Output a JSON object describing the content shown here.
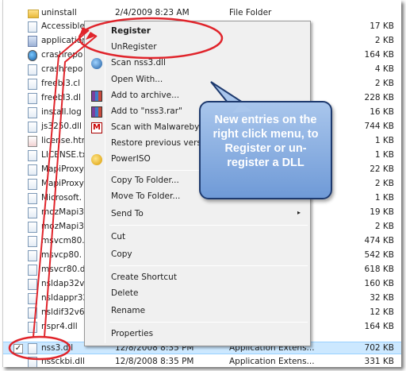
{
  "files": [
    {
      "name": "uninstall",
      "date": "2/4/2009 8:23 AM",
      "type": "File Folder",
      "size": "",
      "icon": "folder-icon"
    },
    {
      "name": "Accessible",
      "date": "",
      "type": "",
      "size": "17 KB",
      "icon": "file-icon"
    },
    {
      "name": "application",
      "date": "",
      "type": "",
      "size": "2 KB",
      "icon": "file-icon"
    },
    {
      "name": "crashrepo",
      "date": "",
      "type": "",
      "size": "164 KB",
      "icon": "crash-icon"
    },
    {
      "name": "crashrepo",
      "date": "",
      "type": "",
      "size": "4 KB",
      "icon": "file-icon"
    },
    {
      "name": "freebl3.cl",
      "date": "",
      "type": "",
      "size": "2 KB",
      "icon": "file-icon"
    },
    {
      "name": "freebl3.dl",
      "date": "",
      "type": "",
      "size": "228 KB",
      "icon": "file-icon"
    },
    {
      "name": "install.log",
      "date": "",
      "type": "",
      "size": "16 KB",
      "icon": "file-icon"
    },
    {
      "name": "js3250.dll",
      "date": "",
      "type": "",
      "size": "744 KB",
      "icon": "file-icon"
    },
    {
      "name": "license.htm",
      "date": "",
      "type": "",
      "size": "1 KB",
      "icon": "doc-icon"
    },
    {
      "name": "LICENSE.txt",
      "date": "",
      "type": "",
      "size": "1 KB",
      "icon": "file-icon"
    },
    {
      "name": "MapiProxy",
      "date": "",
      "type": "",
      "size": "22 KB",
      "icon": "file-icon"
    },
    {
      "name": "MapiProxy",
      "date": "",
      "type": "",
      "size": "2 KB",
      "icon": "file-icon"
    },
    {
      "name": "Microsoft.",
      "date": "",
      "type": "",
      "size": "1 KB",
      "icon": "file-icon"
    },
    {
      "name": "mozMapi3",
      "date": "",
      "type": "",
      "size": "19 KB",
      "icon": "file-icon"
    },
    {
      "name": "mozMapi3",
      "date": "",
      "type": "",
      "size": "2 KB",
      "icon": "file-icon"
    },
    {
      "name": "msvcm80.",
      "date": "",
      "type": "",
      "size": "474 KB",
      "icon": "file-icon"
    },
    {
      "name": "msvcp80.",
      "date": "",
      "type": "",
      "size": "542 KB",
      "icon": "file-icon"
    },
    {
      "name": "msvcr80.d",
      "date": "",
      "type": "",
      "size": "618 KB",
      "icon": "file-icon"
    },
    {
      "name": "nsldap32v",
      "date": "",
      "type": "",
      "size": "160 KB",
      "icon": "file-icon"
    },
    {
      "name": "nsldappr32",
      "date": "",
      "type": "",
      "size": "32 KB",
      "icon": "file-icon"
    },
    {
      "name": "nsldif32v6",
      "date": "",
      "type": "",
      "size": "12 KB",
      "icon": "file-icon"
    },
    {
      "name": "nspr4.dll",
      "date": "",
      "type": "",
      "size": "164 KB",
      "icon": "file-icon"
    },
    {
      "name": "nss3.dll",
      "date": "12/8/2008 8:35 PM",
      "type": "Application Extens...",
      "size": "702 KB",
      "icon": "file-icon",
      "selected": true
    },
    {
      "name": "nssckbi.dll",
      "date": "12/8/2008 8:35 PM",
      "type": "Application Extens...",
      "size": "331 KB",
      "icon": "file-icon"
    }
  ],
  "context_menu": {
    "items": [
      {
        "label": "Register",
        "bold": true
      },
      {
        "label": "UnRegister"
      },
      {
        "label": "Scan nss3.dll",
        "icon": "scan-icon"
      },
      {
        "label": "Open With..."
      },
      {
        "label": "Add to archive...",
        "icon": "winrar-icon"
      },
      {
        "label": "Add to \"nss3.rar\"",
        "icon": "winrar-icon"
      },
      {
        "label": "Scan with Malwareby",
        "icon": "malwarebytes-icon"
      },
      {
        "label": "Restore previous vers"
      },
      {
        "label": "PowerISO",
        "icon": "poweriso-icon"
      },
      {
        "label": "Copy To Folder..."
      },
      {
        "label": "Move To Folder..."
      },
      {
        "label": "Send To",
        "submenu": true
      },
      {
        "label": "Cut"
      },
      {
        "label": "Copy"
      },
      {
        "label": "Create Shortcut"
      },
      {
        "label": "Delete"
      },
      {
        "label": "Rename"
      },
      {
        "label": "Properties"
      }
    ],
    "submenu_arrow": "▸"
  },
  "callout": {
    "lines": [
      "New entries on the",
      "right click menu, to",
      "Register or un-",
      "register a DLL"
    ]
  },
  "selected_check": "✓",
  "colors": {
    "annotation_red": "#e0242b",
    "callout_fill": "#84a8dc",
    "callout_border": "#1e3a6e",
    "selection": "#cce8ff"
  }
}
